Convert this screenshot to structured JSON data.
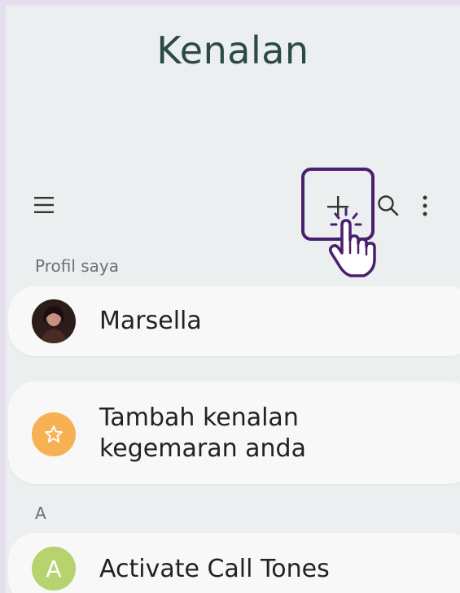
{
  "header": {
    "title": "Kenalan"
  },
  "toolbar": {
    "icons": [
      "menu-icon",
      "add-icon",
      "search-icon",
      "more-vert-icon"
    ]
  },
  "profile_section": {
    "label": "Profil saya",
    "name": "Marsella"
  },
  "favorites": {
    "text": "Tambah kenalan kegemaran anda"
  },
  "contacts_section": {
    "letter": "A",
    "items": [
      {
        "initial": "A",
        "name": "Activate Call Tones"
      }
    ]
  },
  "colors": {
    "background": "#eceff0",
    "title": "#2c4a44",
    "highlight_border": "#4a1f6e",
    "star_avatar": "#f7b052",
    "letter_avatar": "#b7d36f"
  }
}
